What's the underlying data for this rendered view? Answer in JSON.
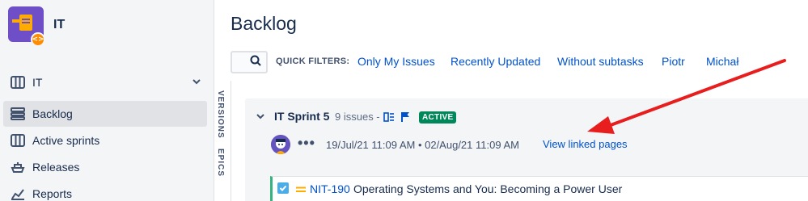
{
  "project": {
    "name": "IT"
  },
  "sidebar": {
    "items": [
      {
        "label": "IT"
      },
      {
        "label": "Backlog"
      },
      {
        "label": "Active sprints"
      },
      {
        "label": "Releases"
      },
      {
        "label": "Reports"
      }
    ]
  },
  "vtabs": {
    "versions": "VERSIONS",
    "epics": "EPICS"
  },
  "page": {
    "title": "Backlog"
  },
  "quick_filters": {
    "label": "QUICK FILTERS:",
    "items": [
      "Only My Issues",
      "Recently Updated",
      "Without subtasks",
      "Piotr",
      "Michał"
    ]
  },
  "sprint": {
    "name": "IT Sprint 5",
    "count": "9 issues -",
    "status": "ACTIVE",
    "more": "•••",
    "dates": "19/Jul/21 11:09 AM • 02/Aug/21 11:09 AM",
    "linked_pages": "View linked pages"
  },
  "issue": {
    "key": "NIT-190",
    "summary": "Operating Systems and You: Becoming a Power User"
  },
  "colors": {
    "accent": "#0052cc",
    "active_badge": "#00875a",
    "arrow": "#e81e1e",
    "project": "#6f4fc8"
  }
}
